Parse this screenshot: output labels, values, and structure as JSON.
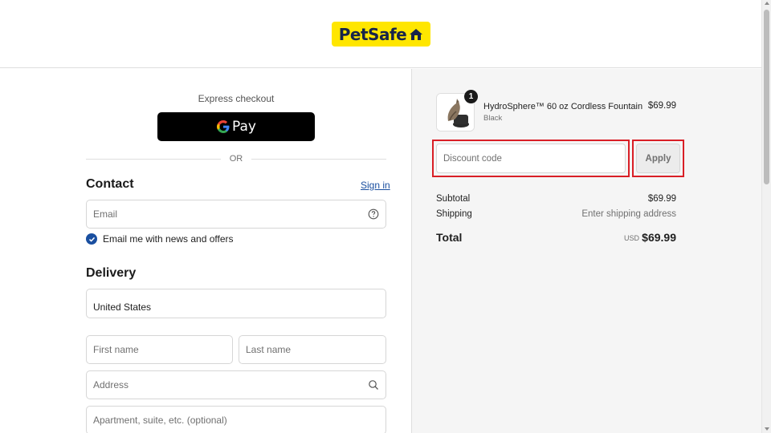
{
  "brand": {
    "logo_text": "PetSafe",
    "logo_bg": "#ffe600",
    "logo_fg": "#17244a"
  },
  "express": {
    "label": "Express checkout",
    "gpay_g": "G",
    "gpay_text": "Pay",
    "or_text": "OR"
  },
  "contact": {
    "title": "Contact",
    "signin_label": "Sign in",
    "email_placeholder": "Email",
    "newsletter_label": "Email me with news and offers",
    "newsletter_checked": true
  },
  "delivery": {
    "title": "Delivery",
    "country_value": "United States",
    "first_name_placeholder": "First name",
    "last_name_placeholder": "Last name",
    "address_placeholder": "Address",
    "apartment_placeholder": "Apartment, suite, etc. (optional)"
  },
  "order": {
    "product": {
      "name": "HydroSphere™ 60 oz Cordless Fountain",
      "variant": "Black",
      "price": "$69.99",
      "quantity": "1"
    },
    "discount_placeholder": "Discount code",
    "apply_label": "Apply",
    "subtotal_label": "Subtotal",
    "subtotal_value": "$69.99",
    "shipping_label": "Shipping",
    "shipping_value": "Enter shipping address",
    "total_label": "Total",
    "currency": "USD",
    "total_value": "$69.99"
  },
  "colors": {
    "accent": "#1a4fa0",
    "highlight": "#d91f26",
    "gpay_bg": "#000000"
  }
}
